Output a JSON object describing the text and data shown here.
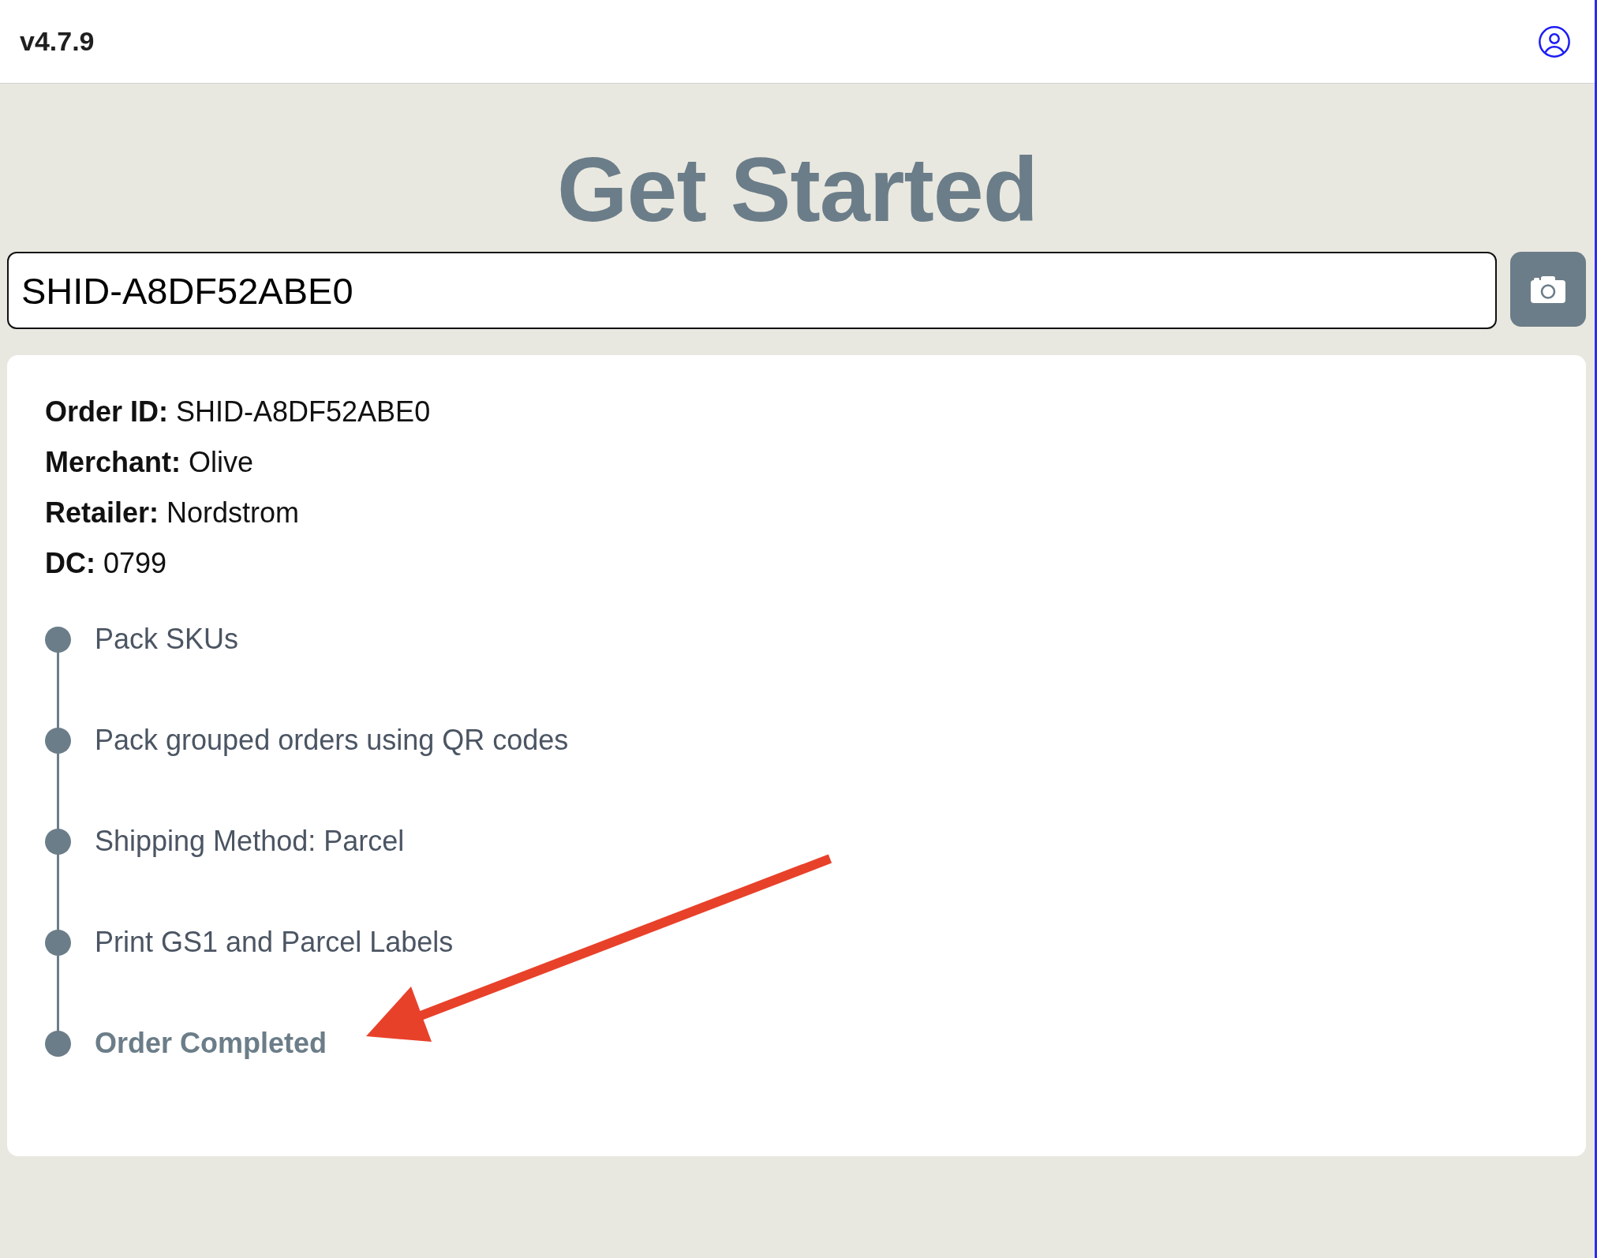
{
  "header": {
    "version": "v4.7.9"
  },
  "title": "Get Started",
  "scan": {
    "value": "SHID-A8DF52ABE0"
  },
  "order": {
    "details": [
      {
        "label": "Order ID:",
        "value": "SHID-A8DF52ABE0"
      },
      {
        "label": "Merchant:",
        "value": "Olive"
      },
      {
        "label": "Retailer:",
        "value": "Nordstrom"
      },
      {
        "label": "DC:",
        "value": "0799"
      }
    ],
    "steps": [
      {
        "label": "Pack SKUs",
        "current": false
      },
      {
        "label": "Pack grouped orders using QR codes",
        "current": false
      },
      {
        "label": "Shipping Method: Parcel",
        "current": false
      },
      {
        "label": "Print GS1 and Parcel Labels",
        "current": false
      },
      {
        "label": "Order Completed",
        "current": true
      }
    ]
  }
}
